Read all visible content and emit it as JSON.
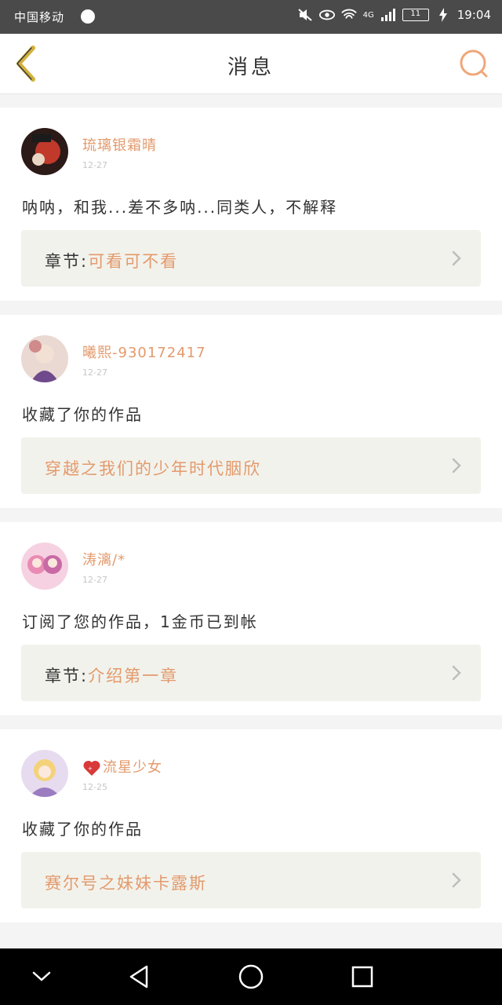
{
  "status_bar": {
    "carrier": "中国移动",
    "network": "4G",
    "battery": "11",
    "time": "19:04"
  },
  "nav": {
    "title": "消息"
  },
  "messages": [
    {
      "user": "琉璃银霜晴",
      "date": "12-27",
      "text": "呐呐，和我...差不多呐...同类人，不解释",
      "ref_key": "章节:",
      "ref_value": "可看可不看",
      "avatar_color": "#8a3b2c"
    },
    {
      "user": "曦熙-930172417",
      "date": "12-27",
      "text": "收藏了你的作品",
      "ref_key": "",
      "ref_value": "穿越之我们的少年时代胭欣",
      "avatar_color": "#c9a79a"
    },
    {
      "user": "涛漓/*",
      "date": "12-27",
      "text": "订阅了您的作品，1金币已到帐",
      "ref_key": "章节:",
      "ref_value": "介绍第一章",
      "avatar_color": "#e7a6c3"
    },
    {
      "user": "流星少女",
      "date": "12-25",
      "text": "收藏了你的作品",
      "ref_key": "",
      "ref_value": "赛尔号之妹妹卡露斯",
      "avatar_color": "#b79ac7"
    }
  ],
  "colors": {
    "accent": "#e39a6c",
    "back_arrow": "#d2b13c",
    "ref_bg": "#f2f2ec"
  }
}
